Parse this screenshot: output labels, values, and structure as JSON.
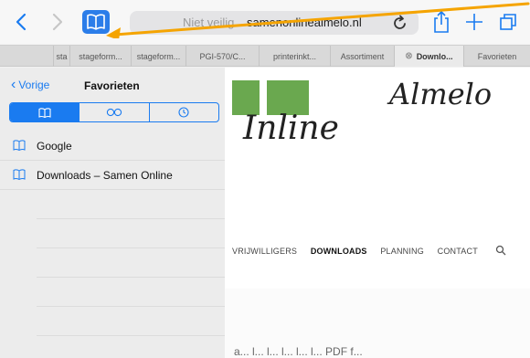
{
  "toolbar": {
    "address": {
      "security_text": "Niet veilig",
      "domain": "samenonlinealmelo.nl"
    }
  },
  "tabs": [
    {
      "label": "sta"
    },
    {
      "label": "stageform..."
    },
    {
      "label": "stageform..."
    },
    {
      "label": "PGI-570/C..."
    },
    {
      "label": "printerinkt..."
    },
    {
      "label": "Assortiment"
    },
    {
      "label": "Downlo..."
    },
    {
      "label": "Favorieten"
    }
  ],
  "sidebar": {
    "back_label": "Vorige",
    "title": "Favorieten",
    "segments": [
      "bookmarks",
      "reading-list",
      "history"
    ],
    "items": [
      {
        "label": "Google"
      },
      {
        "label": "Downloads – Samen Online"
      }
    ]
  },
  "web": {
    "script_top": "Almelo",
    "script_mid": "Inline",
    "menu": [
      "VRIJWILLIGERS",
      "DOWNLOADS",
      "PLANNING",
      "CONTACT"
    ],
    "body_fragment": "a... l... l... l... l... l... PDF f..."
  },
  "colors": {
    "accent": "#1a7bf0",
    "arrow": "#f5a400",
    "logo_green": "#6aa84f"
  }
}
